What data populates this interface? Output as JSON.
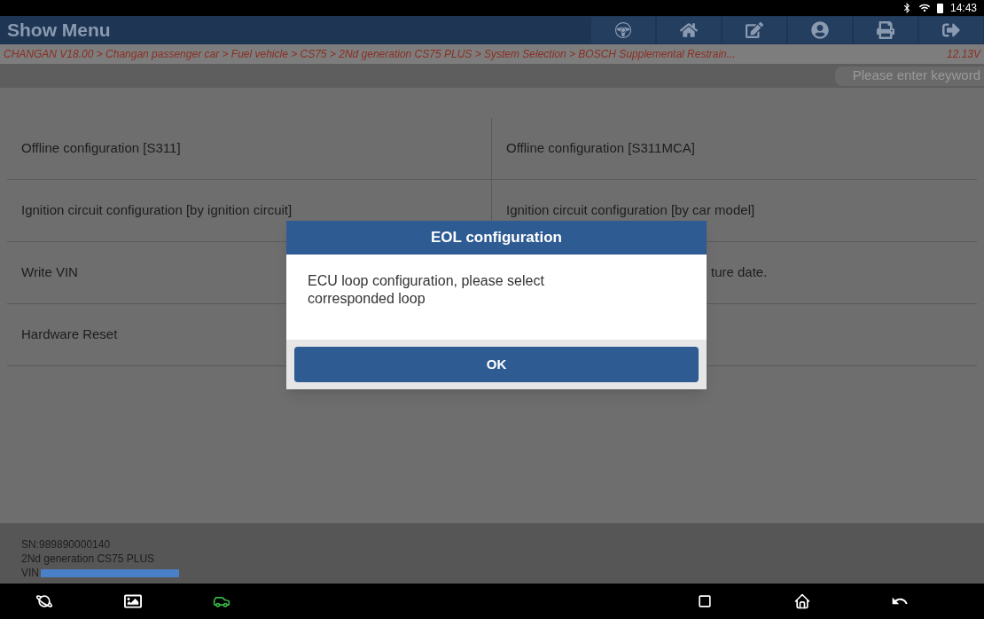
{
  "status_bar": {
    "time": "14:43"
  },
  "header": {
    "title": "Show Menu",
    "tools": [
      {
        "kind": "steering"
      },
      {
        "kind": "home"
      },
      {
        "kind": "edit"
      },
      {
        "kind": "person"
      },
      {
        "kind": "print"
      },
      {
        "kind": "exit"
      }
    ]
  },
  "breadcrumb": {
    "path": "CHANGAN V18.00 > Changan passenger car > Fuel vehicle > CS75 > 2Nd generation CS75 PLUS > System Selection > BOSCH Supplemental Restrain...",
    "voltage": "12.13V"
  },
  "search": {
    "placeholder": "Please enter keyword"
  },
  "menu_rows": [
    {
      "kind": "pair",
      "left": "Offline configuration [S311]",
      "right": "Offline configuration [S311MCA]"
    },
    {
      "kind": "pair",
      "left": "Ignition circuit configuration [by ignition circuit]",
      "right": "Ignition circuit configuration [by car model]"
    },
    {
      "kind": "covered",
      "left": "Write VIN",
      "right": "ture date."
    },
    {
      "kind": "single",
      "left": "Hardware Reset"
    }
  ],
  "info": {
    "sn": "SN:989890000140",
    "model": "2Nd generation CS75 PLUS",
    "vin_label": "VIN"
  },
  "dialog": {
    "title": "EOL configuration",
    "message": "ECU loop configuration, please select corresponded loop",
    "button": "OK"
  },
  "nav_bar": {
    "left": [
      {
        "kind": "browser"
      },
      {
        "kind": "gallery"
      },
      {
        "kind": "vci"
      }
    ],
    "right": [
      {
        "kind": "recent"
      },
      {
        "kind": "home"
      },
      {
        "kind": "back"
      }
    ]
  }
}
